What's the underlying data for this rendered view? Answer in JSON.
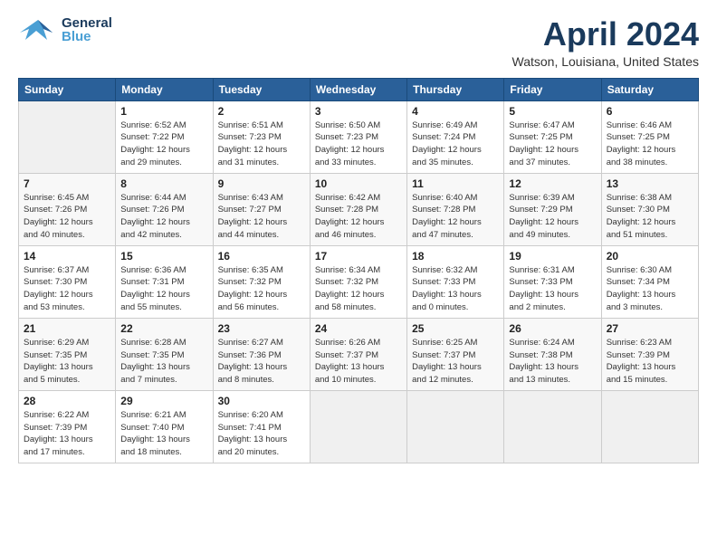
{
  "header": {
    "logo_general": "General",
    "logo_blue": "Blue",
    "month_title": "April 2024",
    "location": "Watson, Louisiana, United States"
  },
  "weekdays": [
    "Sunday",
    "Monday",
    "Tuesday",
    "Wednesday",
    "Thursday",
    "Friday",
    "Saturday"
  ],
  "weeks": [
    [
      {
        "day": "",
        "info": ""
      },
      {
        "day": "1",
        "info": "Sunrise: 6:52 AM\nSunset: 7:22 PM\nDaylight: 12 hours\nand 29 minutes."
      },
      {
        "day": "2",
        "info": "Sunrise: 6:51 AM\nSunset: 7:23 PM\nDaylight: 12 hours\nand 31 minutes."
      },
      {
        "day": "3",
        "info": "Sunrise: 6:50 AM\nSunset: 7:23 PM\nDaylight: 12 hours\nand 33 minutes."
      },
      {
        "day": "4",
        "info": "Sunrise: 6:49 AM\nSunset: 7:24 PM\nDaylight: 12 hours\nand 35 minutes."
      },
      {
        "day": "5",
        "info": "Sunrise: 6:47 AM\nSunset: 7:25 PM\nDaylight: 12 hours\nand 37 minutes."
      },
      {
        "day": "6",
        "info": "Sunrise: 6:46 AM\nSunset: 7:25 PM\nDaylight: 12 hours\nand 38 minutes."
      }
    ],
    [
      {
        "day": "7",
        "info": "Sunrise: 6:45 AM\nSunset: 7:26 PM\nDaylight: 12 hours\nand 40 minutes."
      },
      {
        "day": "8",
        "info": "Sunrise: 6:44 AM\nSunset: 7:26 PM\nDaylight: 12 hours\nand 42 minutes."
      },
      {
        "day": "9",
        "info": "Sunrise: 6:43 AM\nSunset: 7:27 PM\nDaylight: 12 hours\nand 44 minutes."
      },
      {
        "day": "10",
        "info": "Sunrise: 6:42 AM\nSunset: 7:28 PM\nDaylight: 12 hours\nand 46 minutes."
      },
      {
        "day": "11",
        "info": "Sunrise: 6:40 AM\nSunset: 7:28 PM\nDaylight: 12 hours\nand 47 minutes."
      },
      {
        "day": "12",
        "info": "Sunrise: 6:39 AM\nSunset: 7:29 PM\nDaylight: 12 hours\nand 49 minutes."
      },
      {
        "day": "13",
        "info": "Sunrise: 6:38 AM\nSunset: 7:30 PM\nDaylight: 12 hours\nand 51 minutes."
      }
    ],
    [
      {
        "day": "14",
        "info": "Sunrise: 6:37 AM\nSunset: 7:30 PM\nDaylight: 12 hours\nand 53 minutes."
      },
      {
        "day": "15",
        "info": "Sunrise: 6:36 AM\nSunset: 7:31 PM\nDaylight: 12 hours\nand 55 minutes."
      },
      {
        "day": "16",
        "info": "Sunrise: 6:35 AM\nSunset: 7:32 PM\nDaylight: 12 hours\nand 56 minutes."
      },
      {
        "day": "17",
        "info": "Sunrise: 6:34 AM\nSunset: 7:32 PM\nDaylight: 12 hours\nand 58 minutes."
      },
      {
        "day": "18",
        "info": "Sunrise: 6:32 AM\nSunset: 7:33 PM\nDaylight: 13 hours\nand 0 minutes."
      },
      {
        "day": "19",
        "info": "Sunrise: 6:31 AM\nSunset: 7:33 PM\nDaylight: 13 hours\nand 2 minutes."
      },
      {
        "day": "20",
        "info": "Sunrise: 6:30 AM\nSunset: 7:34 PM\nDaylight: 13 hours\nand 3 minutes."
      }
    ],
    [
      {
        "day": "21",
        "info": "Sunrise: 6:29 AM\nSunset: 7:35 PM\nDaylight: 13 hours\nand 5 minutes."
      },
      {
        "day": "22",
        "info": "Sunrise: 6:28 AM\nSunset: 7:35 PM\nDaylight: 13 hours\nand 7 minutes."
      },
      {
        "day": "23",
        "info": "Sunrise: 6:27 AM\nSunset: 7:36 PM\nDaylight: 13 hours\nand 8 minutes."
      },
      {
        "day": "24",
        "info": "Sunrise: 6:26 AM\nSunset: 7:37 PM\nDaylight: 13 hours\nand 10 minutes."
      },
      {
        "day": "25",
        "info": "Sunrise: 6:25 AM\nSunset: 7:37 PM\nDaylight: 13 hours\nand 12 minutes."
      },
      {
        "day": "26",
        "info": "Sunrise: 6:24 AM\nSunset: 7:38 PM\nDaylight: 13 hours\nand 13 minutes."
      },
      {
        "day": "27",
        "info": "Sunrise: 6:23 AM\nSunset: 7:39 PM\nDaylight: 13 hours\nand 15 minutes."
      }
    ],
    [
      {
        "day": "28",
        "info": "Sunrise: 6:22 AM\nSunset: 7:39 PM\nDaylight: 13 hours\nand 17 minutes."
      },
      {
        "day": "29",
        "info": "Sunrise: 6:21 AM\nSunset: 7:40 PM\nDaylight: 13 hours\nand 18 minutes."
      },
      {
        "day": "30",
        "info": "Sunrise: 6:20 AM\nSunset: 7:41 PM\nDaylight: 13 hours\nand 20 minutes."
      },
      {
        "day": "",
        "info": ""
      },
      {
        "day": "",
        "info": ""
      },
      {
        "day": "",
        "info": ""
      },
      {
        "day": "",
        "info": ""
      }
    ]
  ]
}
